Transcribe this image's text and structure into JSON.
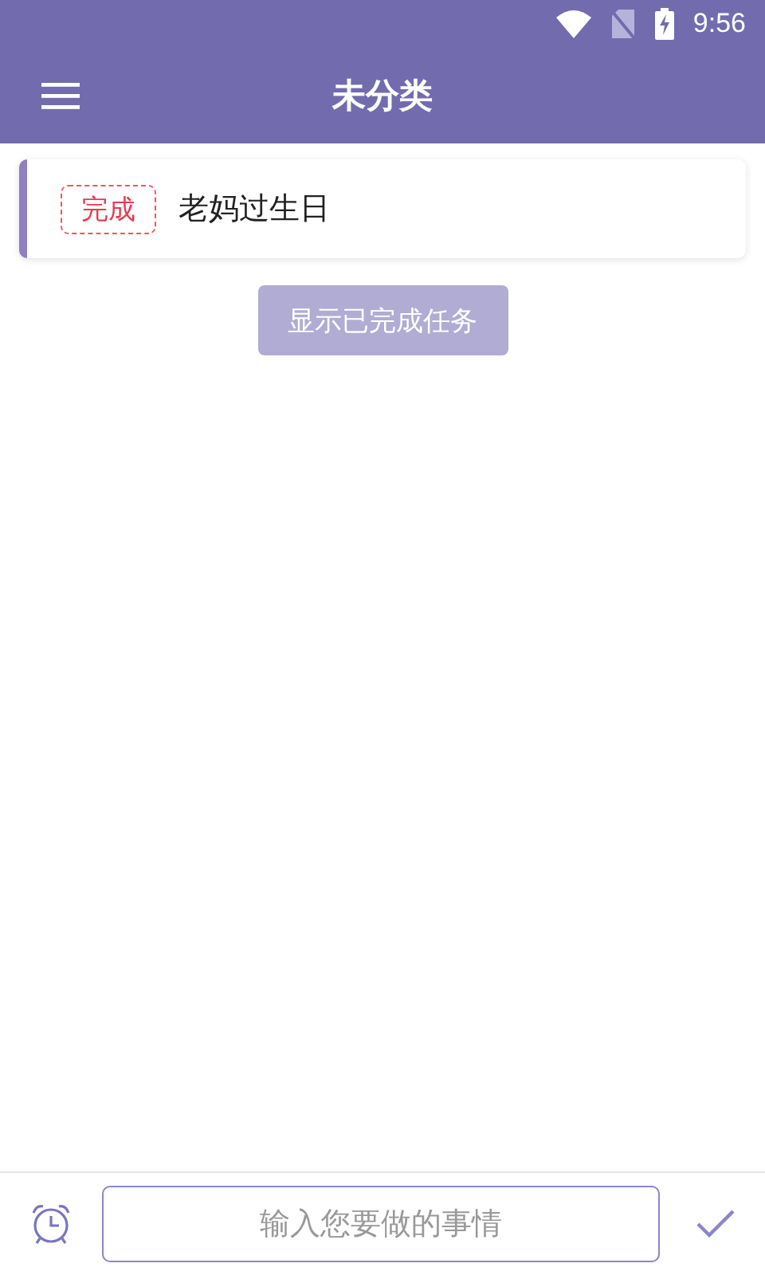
{
  "status_bar": {
    "time": "9:56"
  },
  "app_bar": {
    "title": "未分类"
  },
  "tasks": [
    {
      "badge": "完成",
      "title": "老妈过生日"
    }
  ],
  "show_completed_button": "显示已完成任务",
  "input": {
    "placeholder": "输入您要做的事情"
  }
}
